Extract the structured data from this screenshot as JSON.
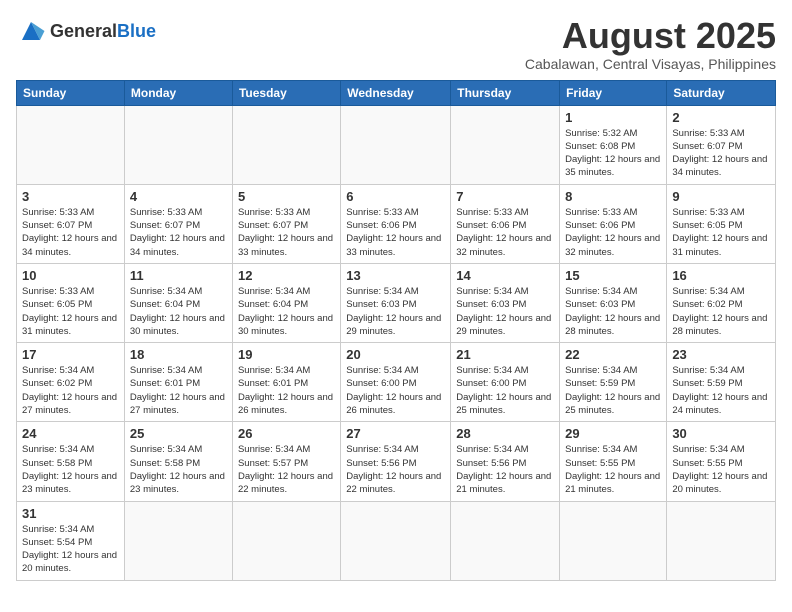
{
  "logo": {
    "text_general": "General",
    "text_blue": "Blue"
  },
  "title": "August 2025",
  "subtitle": "Cabalawan, Central Visayas, Philippines",
  "weekdays": [
    "Sunday",
    "Monday",
    "Tuesday",
    "Wednesday",
    "Thursday",
    "Friday",
    "Saturday"
  ],
  "weeks": [
    [
      {
        "day": "",
        "info": ""
      },
      {
        "day": "",
        "info": ""
      },
      {
        "day": "",
        "info": ""
      },
      {
        "day": "",
        "info": ""
      },
      {
        "day": "",
        "info": ""
      },
      {
        "day": "1",
        "info": "Sunrise: 5:32 AM\nSunset: 6:08 PM\nDaylight: 12 hours\nand 35 minutes."
      },
      {
        "day": "2",
        "info": "Sunrise: 5:33 AM\nSunset: 6:07 PM\nDaylight: 12 hours\nand 34 minutes."
      }
    ],
    [
      {
        "day": "3",
        "info": "Sunrise: 5:33 AM\nSunset: 6:07 PM\nDaylight: 12 hours\nand 34 minutes."
      },
      {
        "day": "4",
        "info": "Sunrise: 5:33 AM\nSunset: 6:07 PM\nDaylight: 12 hours\nand 34 minutes."
      },
      {
        "day": "5",
        "info": "Sunrise: 5:33 AM\nSunset: 6:07 PM\nDaylight: 12 hours\nand 33 minutes."
      },
      {
        "day": "6",
        "info": "Sunrise: 5:33 AM\nSunset: 6:06 PM\nDaylight: 12 hours\nand 33 minutes."
      },
      {
        "day": "7",
        "info": "Sunrise: 5:33 AM\nSunset: 6:06 PM\nDaylight: 12 hours\nand 32 minutes."
      },
      {
        "day": "8",
        "info": "Sunrise: 5:33 AM\nSunset: 6:06 PM\nDaylight: 12 hours\nand 32 minutes."
      },
      {
        "day": "9",
        "info": "Sunrise: 5:33 AM\nSunset: 6:05 PM\nDaylight: 12 hours\nand 31 minutes."
      }
    ],
    [
      {
        "day": "10",
        "info": "Sunrise: 5:33 AM\nSunset: 6:05 PM\nDaylight: 12 hours\nand 31 minutes."
      },
      {
        "day": "11",
        "info": "Sunrise: 5:34 AM\nSunset: 6:04 PM\nDaylight: 12 hours\nand 30 minutes."
      },
      {
        "day": "12",
        "info": "Sunrise: 5:34 AM\nSunset: 6:04 PM\nDaylight: 12 hours\nand 30 minutes."
      },
      {
        "day": "13",
        "info": "Sunrise: 5:34 AM\nSunset: 6:03 PM\nDaylight: 12 hours\nand 29 minutes."
      },
      {
        "day": "14",
        "info": "Sunrise: 5:34 AM\nSunset: 6:03 PM\nDaylight: 12 hours\nand 29 minutes."
      },
      {
        "day": "15",
        "info": "Sunrise: 5:34 AM\nSunset: 6:03 PM\nDaylight: 12 hours\nand 28 minutes."
      },
      {
        "day": "16",
        "info": "Sunrise: 5:34 AM\nSunset: 6:02 PM\nDaylight: 12 hours\nand 28 minutes."
      }
    ],
    [
      {
        "day": "17",
        "info": "Sunrise: 5:34 AM\nSunset: 6:02 PM\nDaylight: 12 hours\nand 27 minutes."
      },
      {
        "day": "18",
        "info": "Sunrise: 5:34 AM\nSunset: 6:01 PM\nDaylight: 12 hours\nand 27 minutes."
      },
      {
        "day": "19",
        "info": "Sunrise: 5:34 AM\nSunset: 6:01 PM\nDaylight: 12 hours\nand 26 minutes."
      },
      {
        "day": "20",
        "info": "Sunrise: 5:34 AM\nSunset: 6:00 PM\nDaylight: 12 hours\nand 26 minutes."
      },
      {
        "day": "21",
        "info": "Sunrise: 5:34 AM\nSunset: 6:00 PM\nDaylight: 12 hours\nand 25 minutes."
      },
      {
        "day": "22",
        "info": "Sunrise: 5:34 AM\nSunset: 5:59 PM\nDaylight: 12 hours\nand 25 minutes."
      },
      {
        "day": "23",
        "info": "Sunrise: 5:34 AM\nSunset: 5:59 PM\nDaylight: 12 hours\nand 24 minutes."
      }
    ],
    [
      {
        "day": "24",
        "info": "Sunrise: 5:34 AM\nSunset: 5:58 PM\nDaylight: 12 hours\nand 23 minutes."
      },
      {
        "day": "25",
        "info": "Sunrise: 5:34 AM\nSunset: 5:58 PM\nDaylight: 12 hours\nand 23 minutes."
      },
      {
        "day": "26",
        "info": "Sunrise: 5:34 AM\nSunset: 5:57 PM\nDaylight: 12 hours\nand 22 minutes."
      },
      {
        "day": "27",
        "info": "Sunrise: 5:34 AM\nSunset: 5:56 PM\nDaylight: 12 hours\nand 22 minutes."
      },
      {
        "day": "28",
        "info": "Sunrise: 5:34 AM\nSunset: 5:56 PM\nDaylight: 12 hours\nand 21 minutes."
      },
      {
        "day": "29",
        "info": "Sunrise: 5:34 AM\nSunset: 5:55 PM\nDaylight: 12 hours\nand 21 minutes."
      },
      {
        "day": "30",
        "info": "Sunrise: 5:34 AM\nSunset: 5:55 PM\nDaylight: 12 hours\nand 20 minutes."
      }
    ],
    [
      {
        "day": "31",
        "info": "Sunrise: 5:34 AM\nSunset: 5:54 PM\nDaylight: 12 hours\nand 20 minutes."
      },
      {
        "day": "",
        "info": ""
      },
      {
        "day": "",
        "info": ""
      },
      {
        "day": "",
        "info": ""
      },
      {
        "day": "",
        "info": ""
      },
      {
        "day": "",
        "info": ""
      },
      {
        "day": "",
        "info": ""
      }
    ]
  ]
}
